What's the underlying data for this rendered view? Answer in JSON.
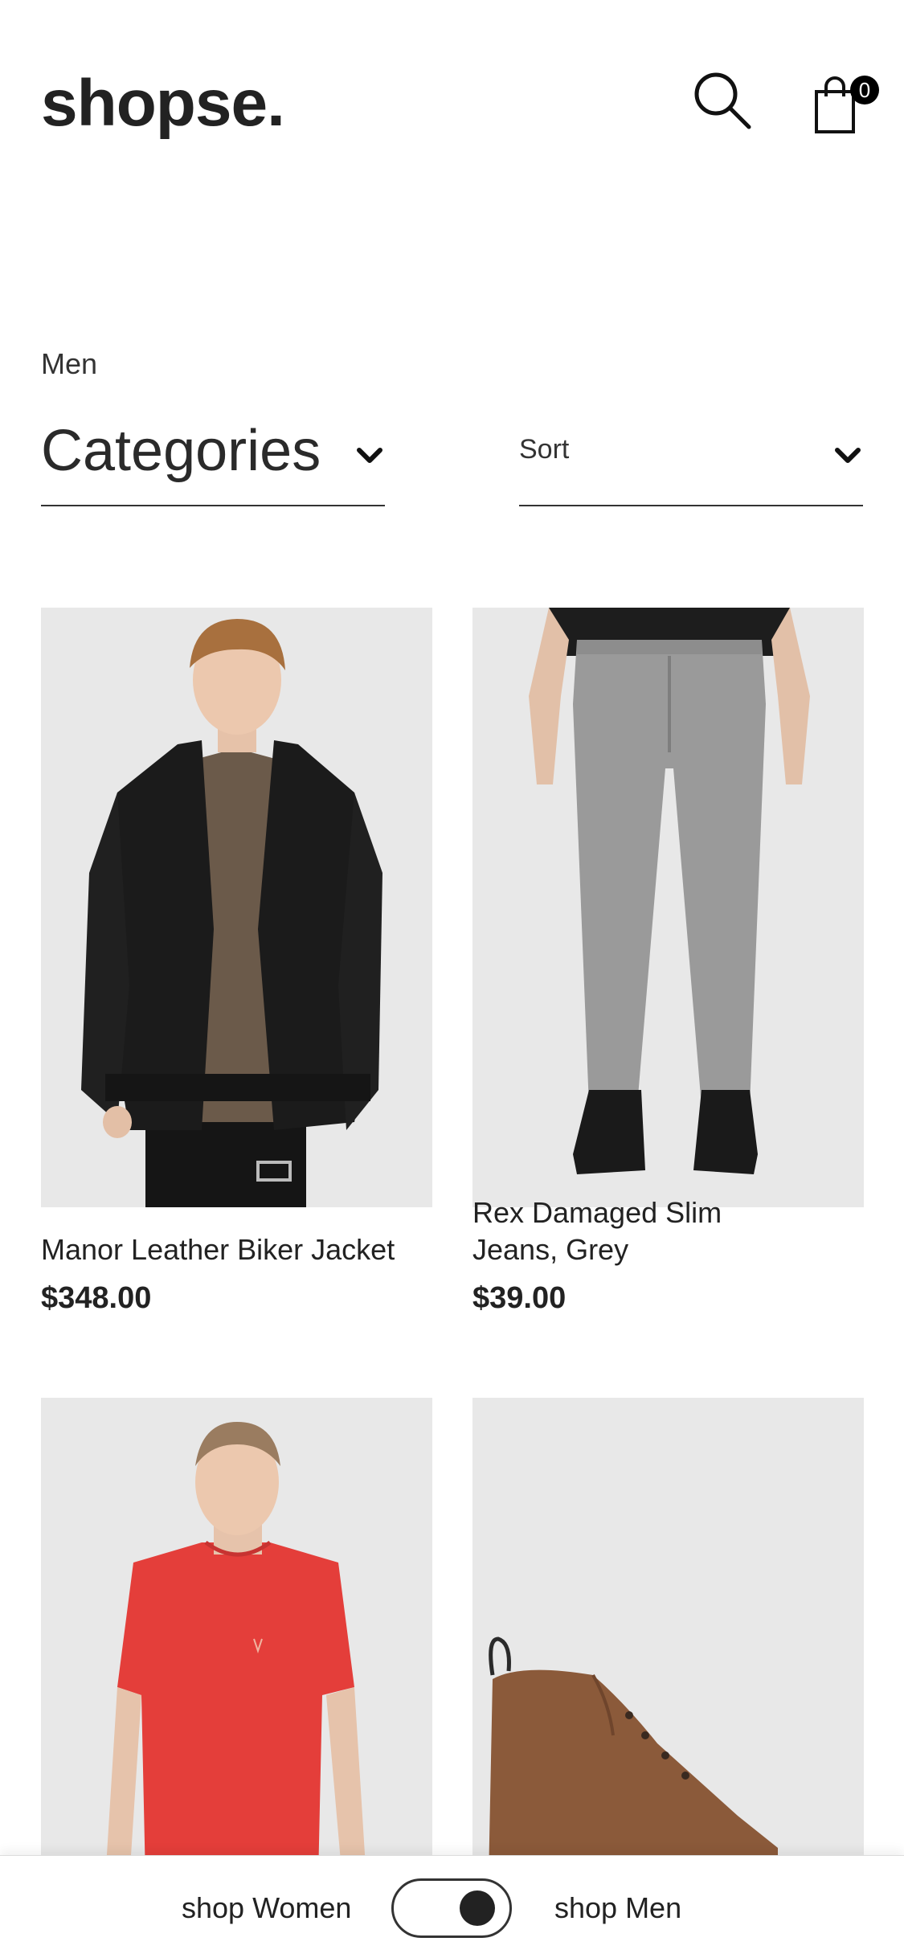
{
  "app": {
    "logo": "shopse.",
    "cart_count": "0"
  },
  "filters": {
    "breadcrumb": "Men",
    "categories_label": "Categories",
    "sort_label": "Sort"
  },
  "products": [
    {
      "name": "Manor Leather Biker Jacket",
      "price": "$348.00"
    },
    {
      "name": "Rex Damaged Slim Jeans, Grey",
      "price": "$39.00"
    },
    {
      "name": "",
      "price": ""
    },
    {
      "name": "",
      "price": ""
    }
  ],
  "bottom_bar": {
    "left_label": "shop Women",
    "right_label": "shop Men",
    "toggle_state": "men"
  },
  "icons": {
    "search": "search-icon",
    "cart": "shopping-bag-icon",
    "dropdown": "chevron-down-icon"
  },
  "colors": {
    "text": "#222222",
    "image_bg": "#e8e8e8",
    "badge": "#000000"
  }
}
